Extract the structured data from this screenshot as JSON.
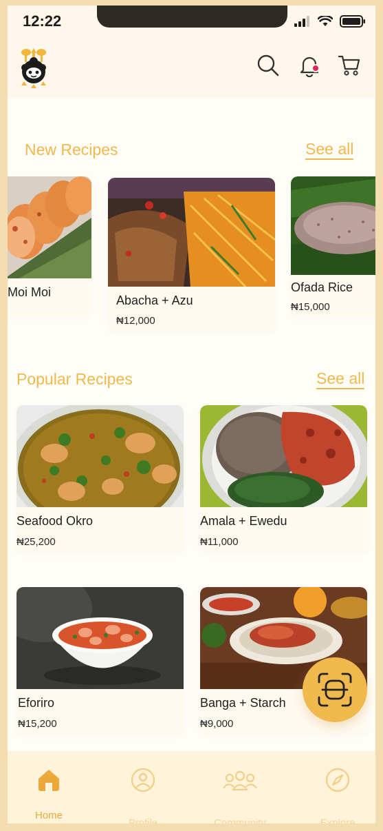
{
  "status_bar": {
    "time": "12:22"
  },
  "sections": {
    "new_recipes": {
      "title": "New Recipes",
      "see_all": "See all"
    },
    "popular_recipes": {
      "title": "Popular Recipes",
      "see_all": "See all"
    }
  },
  "new_recipes": [
    {
      "name": "Moi Moi",
      "price": "₦"
    },
    {
      "name": "Abacha + Azu",
      "price": "₦12,000"
    },
    {
      "name": "Ofada Rice",
      "price": "₦15,000"
    }
  ],
  "popular_recipes": [
    {
      "name": "Seafood Okro",
      "price": "₦25,200"
    },
    {
      "name": "Amala + Ewedu",
      "price": "₦11,000"
    },
    {
      "name": "Eforiro",
      "price": "₦15,200"
    },
    {
      "name": "Banga + Starch",
      "price": "₦9,000"
    }
  ],
  "nav": [
    {
      "label": "Home",
      "icon": "home-icon",
      "active": true
    },
    {
      "label": "Profile",
      "icon": "profile-icon"
    },
    {
      "label": "Community",
      "icon": "community-icon"
    },
    {
      "label": "Explore",
      "icon": "compass-icon"
    }
  ],
  "colors": {
    "accent": "#efb94e",
    "background": "#fffdf7",
    "notification": "#e0245e"
  }
}
